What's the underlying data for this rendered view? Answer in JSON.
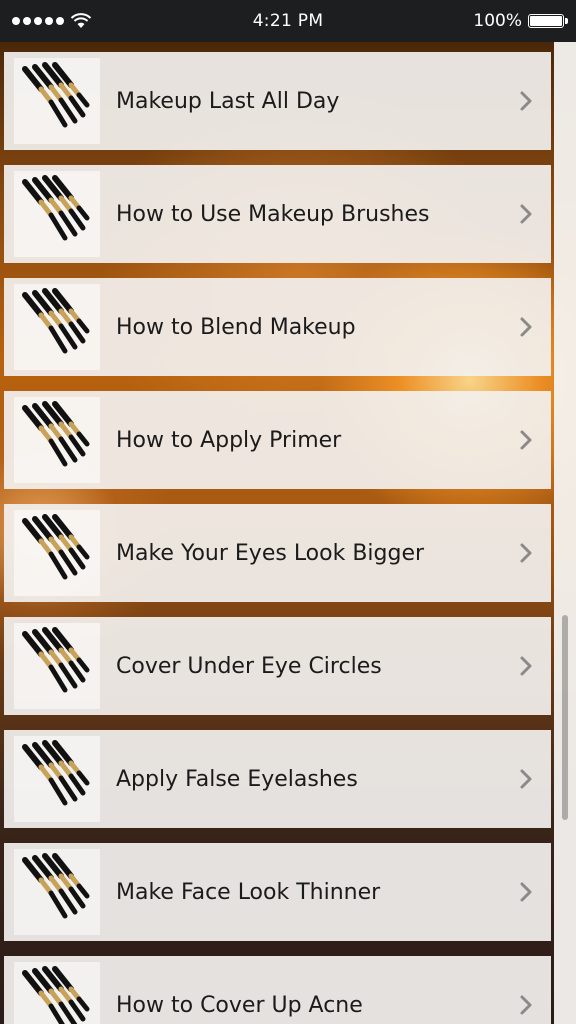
{
  "status_bar": {
    "time": "4:21 PM",
    "battery_percent": "100%",
    "signal_icon": "signal-dots-icon",
    "wifi_icon": "wifi-icon",
    "battery_icon": "battery-icon"
  },
  "list": {
    "items": [
      {
        "label": "Makeup Last All Day",
        "icon": "makeup-brushes-icon"
      },
      {
        "label": "How to Use Makeup Brushes",
        "icon": "makeup-brushes-icon"
      },
      {
        "label": "How to Blend Makeup",
        "icon": "makeup-brushes-icon"
      },
      {
        "label": "How to Apply Primer",
        "icon": "makeup-brushes-icon"
      },
      {
        "label": "Make Your Eyes Look Bigger",
        "icon": "makeup-brushes-icon"
      },
      {
        "label": "Cover Under Eye Circles",
        "icon": "makeup-brushes-icon"
      },
      {
        "label": "Apply False Eyelashes",
        "icon": "makeup-brushes-icon"
      },
      {
        "label": "Make Face Look Thinner",
        "icon": "makeup-brushes-icon"
      },
      {
        "label": "How to Cover Up Acne",
        "icon": "makeup-brushes-icon"
      }
    ]
  }
}
